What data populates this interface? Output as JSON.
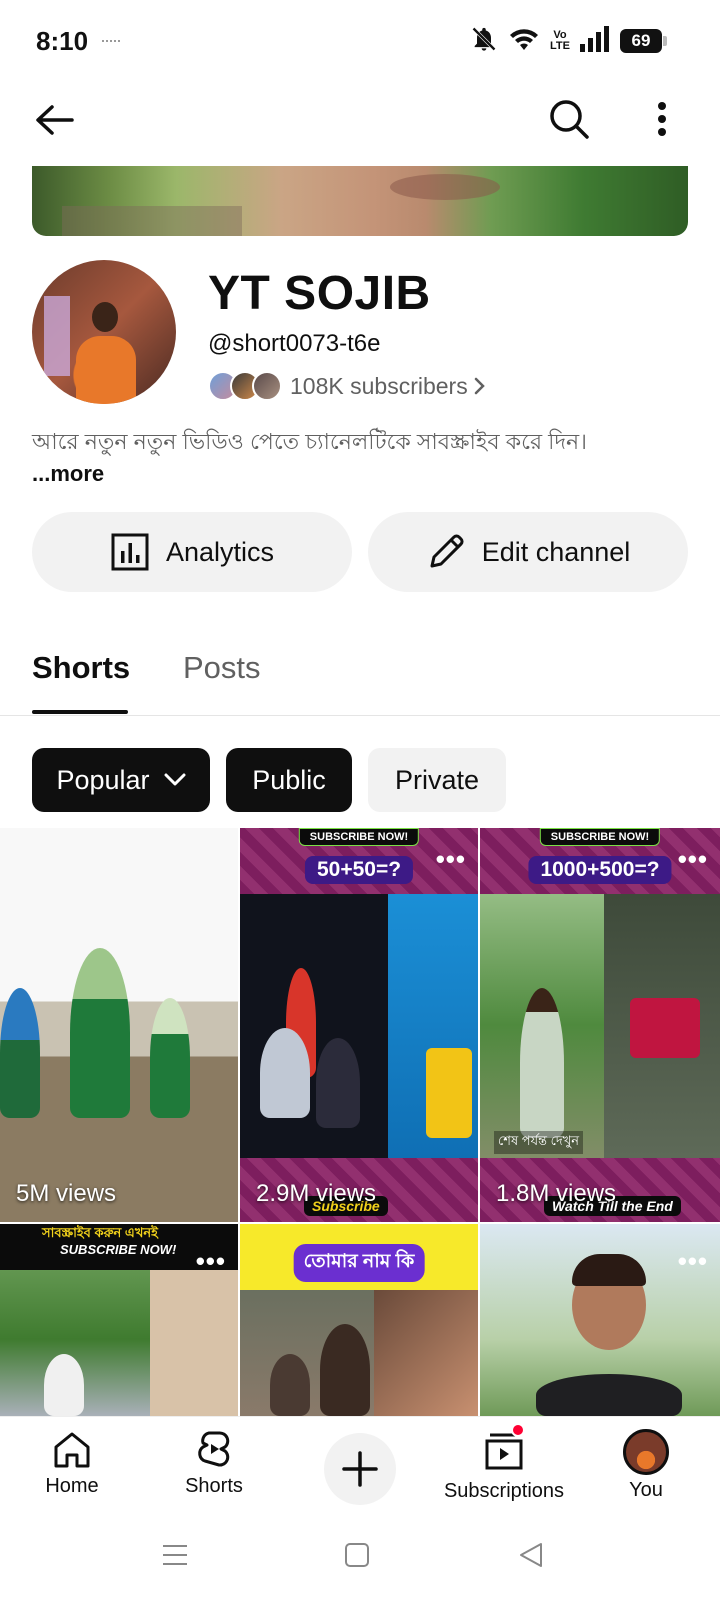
{
  "status_bar": {
    "time": "8:10",
    "network_label_top": "Vo",
    "network_label_bottom": "LTE",
    "battery": "69",
    "icons": [
      "bell-off-icon",
      "wifi-icon",
      "volte-icon",
      "signal-icon",
      "battery-icon"
    ]
  },
  "top_bar": {
    "icons": [
      "back-arrow-icon",
      "search-icon",
      "more-vert-icon"
    ]
  },
  "channel": {
    "name": "YT SOJIB",
    "handle": "@short0073-t6e",
    "subscribers": "108K subscribers",
    "description": "আরে নতুন নতুন ভিডিও পেতে চ্যানেলটিকে সাবস্ক্রাইব করে দিন। ",
    "more_label": "...more"
  },
  "actions": {
    "analytics_label": "Analytics",
    "edit_label": "Edit channel"
  },
  "tabs": [
    {
      "label": "Shorts",
      "selected": true
    },
    {
      "label": "Posts",
      "selected": false
    }
  ],
  "chips": {
    "popular": "Popular",
    "public": "Public",
    "private": "Private",
    "selected": [
      "Popular",
      "Public"
    ]
  },
  "shorts": [
    {
      "views": "5M views"
    },
    {
      "views": "2.9M views",
      "banner": "SUBSCRIBE NOW!",
      "overlay": "50+50=?",
      "footer": "Subscribe"
    },
    {
      "views": "1.8M views",
      "banner": "SUBSCRIBE NOW!",
      "overlay": "1000+500=?",
      "caption": "শেষ পর্যন্ত দেখুন",
      "footer": "Watch Till the End"
    },
    {
      "views": "",
      "banner_bn": "সাবস্ক্রাইব করুন এখনই",
      "banner": "SUBSCRIBE NOW!"
    },
    {
      "views": "",
      "overlay": "তোমার নাম কি"
    },
    {
      "views": ""
    }
  ],
  "bottom_nav": [
    {
      "label": "Home",
      "icon": "home-icon"
    },
    {
      "label": "Shorts",
      "icon": "shorts-icon"
    },
    {
      "label": "",
      "icon": "add-icon"
    },
    {
      "label": "Subscriptions",
      "icon": "subscriptions-icon",
      "badge": true
    },
    {
      "label": "You",
      "icon": "profile-avatar"
    }
  ],
  "colors": {
    "text_primary": "#0f0f0f",
    "text_secondary": "#606060",
    "chip_dark": "#0f0f0f",
    "chip_light": "#f2f2f2",
    "badge_red": "#ff0033"
  }
}
